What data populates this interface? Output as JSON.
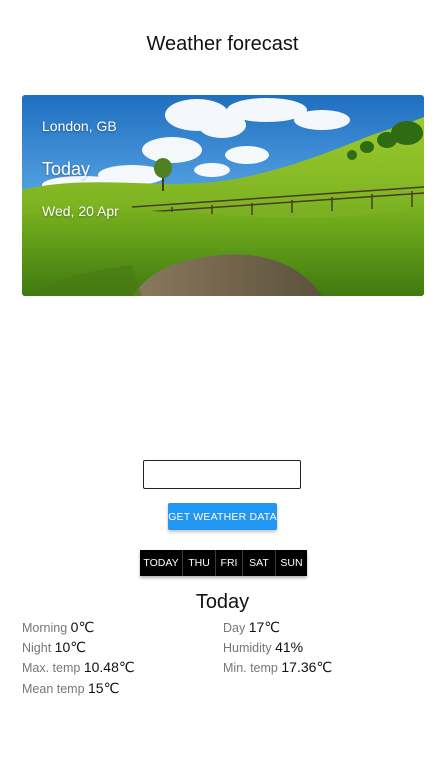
{
  "header": {
    "title": "Weather forecast"
  },
  "hero": {
    "location": "London, GB",
    "day": "Today",
    "date": "Wed, 20 Apr"
  },
  "search": {
    "value": "",
    "placeholder": ""
  },
  "actions": {
    "get_weather_label": "GET WEATHER DATA"
  },
  "tabs": [
    {
      "label": "TODAY"
    },
    {
      "label": "THU"
    },
    {
      "label": "FRI"
    },
    {
      "label": "SAT"
    },
    {
      "label": "SUN"
    }
  ],
  "details": {
    "title": "Today",
    "morning": {
      "label": "Morning",
      "value": "0℃"
    },
    "day": {
      "label": "Day",
      "value": "17℃"
    },
    "night": {
      "label": "Night",
      "value": "10℃"
    },
    "humidity": {
      "label": "Humidity",
      "value": "41%"
    },
    "max_temp": {
      "label": "Max. temp",
      "value": "10.48℃"
    },
    "min_temp": {
      "label": "Min. temp",
      "value": "17.36℃"
    },
    "mean_temp": {
      "label": "Mean temp",
      "value": "15℃"
    }
  },
  "colors": {
    "accent": "#2196f3",
    "tab_background": "#000000",
    "label_text": "#777777"
  }
}
